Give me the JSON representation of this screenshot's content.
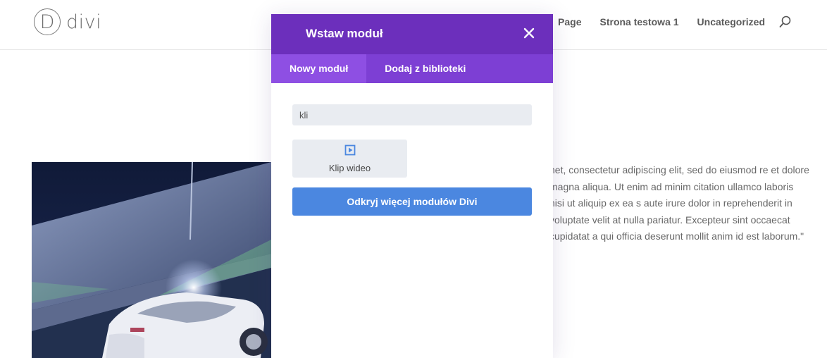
{
  "header": {
    "logo_letter": "D",
    "logo_text": "divi",
    "nav": [
      "Page",
      "Strona testowa 1",
      "Uncategorized"
    ],
    "search_icon": "search-icon"
  },
  "content": {
    "paragraph": "net, consectetur adipiscing elit, sed do eiusmod re et dolore magna aliqua. Ut enim ad minim citation ullamco laboris nisi ut aliquip ex ea s aute irure dolor in reprehenderit in voluptate velit at nulla pariatur. Excepteur sint occaecat cupidatat a qui officia deserunt mollit anim id est laborum.\""
  },
  "modal": {
    "title": "Wstaw moduł",
    "close_icon": "close-icon",
    "tabs": [
      {
        "label": "Nowy moduł",
        "active": true
      },
      {
        "label": "Dodaj z biblioteki",
        "active": false
      }
    ],
    "search_value": "kli",
    "modules": [
      {
        "label": "Klip wideo",
        "icon": "video-play-icon"
      }
    ],
    "discover_label": "Odkryj więcej modułów Divi"
  },
  "colors": {
    "modal_header": "#6c2fbc",
    "modal_tabs": "#7d3fd4",
    "tab_active": "#8e4fe3",
    "discover_button": "#4b87e0"
  }
}
